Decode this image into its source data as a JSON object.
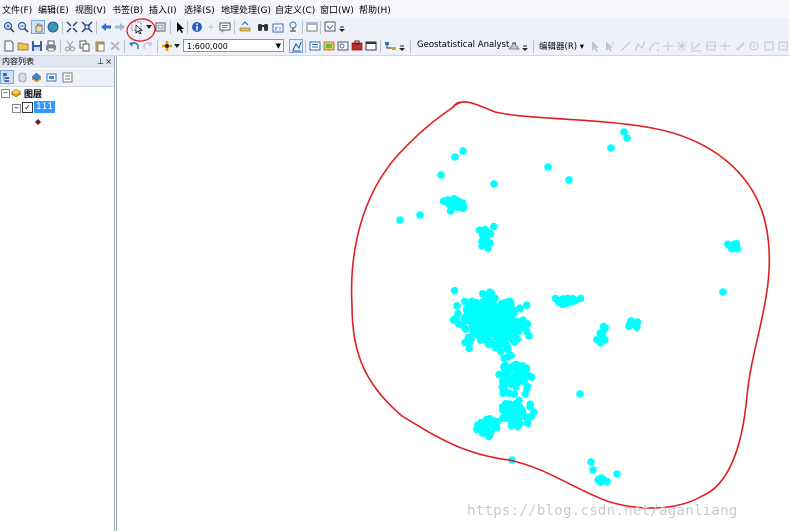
{
  "menubar": {
    "items": [
      "文件(F)",
      "编辑(E)",
      "视图(V)",
      "书签(B)",
      "插入(I)",
      "选择(S)",
      "地理处理(G)",
      "自定义(C)",
      "窗口(W)",
      "帮助(H)"
    ]
  },
  "toolbar2": {
    "scale_value": "1:600,000",
    "geostat_label": "Geostatistical Analyst",
    "editor_label": "编辑器(R)"
  },
  "toc": {
    "title": "内容列表",
    "pin_glyph": "⊥",
    "close_glyph": "×",
    "layers_group": "图层",
    "layer_name": "111"
  },
  "colors": {
    "points": "#00ffff",
    "annotation": "#e02020",
    "selection": "#3399ff"
  },
  "watermark": "https://blog.csdn.net/aganliang"
}
